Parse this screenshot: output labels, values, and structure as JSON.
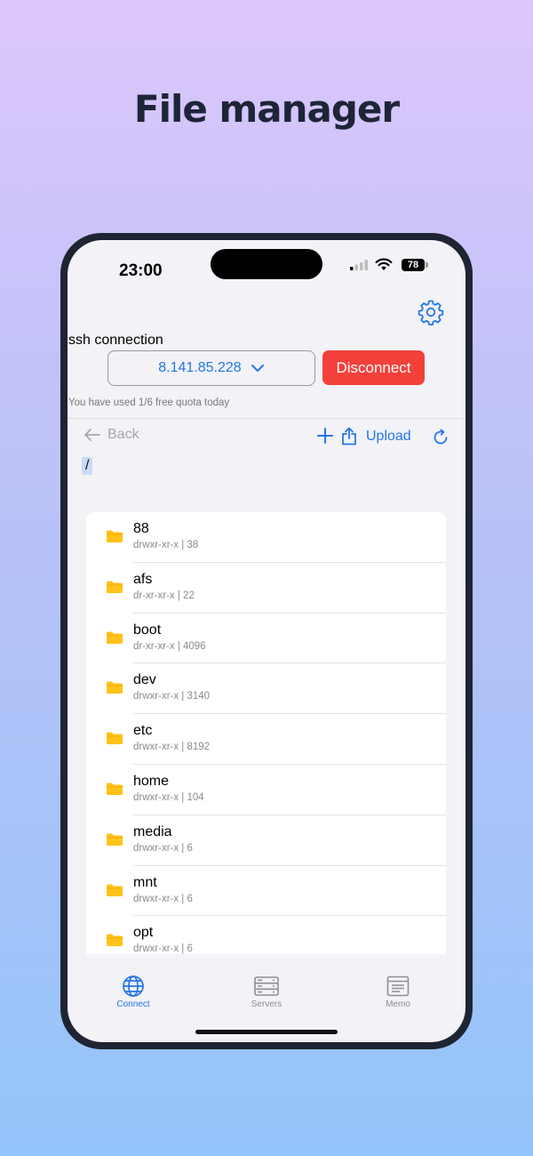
{
  "promo": {
    "headline": "File manager"
  },
  "status_bar": {
    "time": "23:00",
    "battery": "78"
  },
  "connection": {
    "label": "ssh connection",
    "server_address": "8.141.85.228",
    "disconnect_label": "Disconnect",
    "quota_text": "You have used 1/6 free quota today"
  },
  "toolbar": {
    "back_label": "Back",
    "upload_label": "Upload"
  },
  "path": "/",
  "files": [
    {
      "name": "88",
      "meta": "drwxr-xr-x | 38"
    },
    {
      "name": "afs",
      "meta": "dr-xr-xr-x | 22"
    },
    {
      "name": "boot",
      "meta": "dr-xr-xr-x | 4096"
    },
    {
      "name": "dev",
      "meta": "drwxr-xr-x | 3140"
    },
    {
      "name": "etc",
      "meta": "drwxr-xr-x | 8192"
    },
    {
      "name": "home",
      "meta": "drwxr-xr-x | 104"
    },
    {
      "name": "media",
      "meta": "drwxr-xr-x | 6"
    },
    {
      "name": "mnt",
      "meta": "drwxr-xr-x | 6"
    },
    {
      "name": "opt",
      "meta": "drwxr-xr-x | 6"
    }
  ],
  "tabs": [
    {
      "label": "Connect",
      "icon": "globe-icon",
      "active": true
    },
    {
      "label": "Servers",
      "icon": "server-icon",
      "active": false
    },
    {
      "label": "Memo",
      "icon": "memo-icon",
      "active": false
    }
  ],
  "colors": {
    "accent": "#2477e6",
    "danger": "#f2413b",
    "folder": "#ffc21a"
  }
}
